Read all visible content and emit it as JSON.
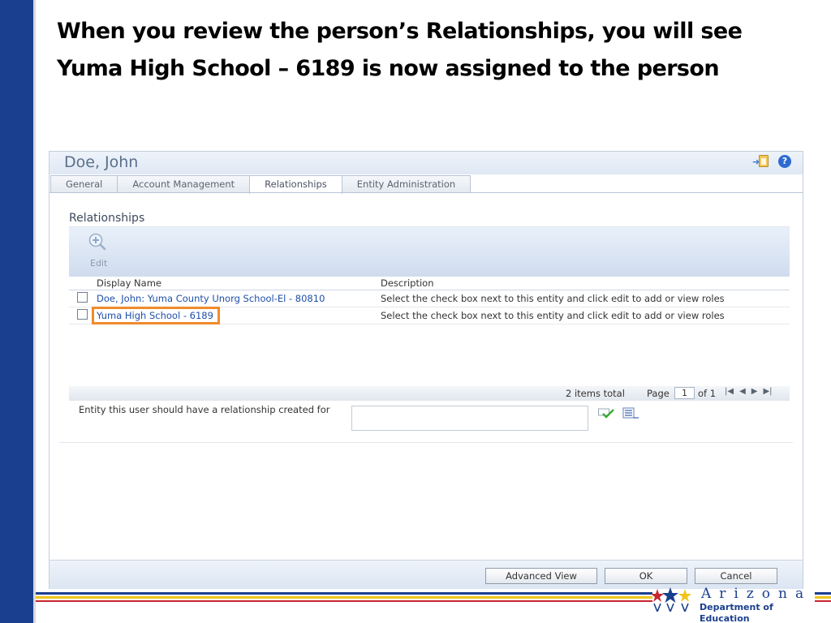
{
  "slide": {
    "title": "When you review the person’s Relationships, you will see Yuma High School – 6189 is now assigned to the person"
  },
  "app": {
    "title": "Doe, John",
    "tabs": [
      {
        "label": "General"
      },
      {
        "label": "Account Management"
      },
      {
        "label": "Relationships",
        "active": true
      },
      {
        "label": "Entity Administration"
      }
    ],
    "section_label": "Relationships",
    "toolbar": {
      "edit_label": "Edit"
    },
    "grid": {
      "columns": [
        "Display Name",
        "Description"
      ],
      "rows": [
        {
          "name": "Doe, John: Yuma County Unorg School-El - 80810",
          "description": "Select the check box next to this entity and click edit to add or view roles"
        },
        {
          "name": "Yuma High School - 6189",
          "description": "Select the check box next to this entity and click edit to add or view roles",
          "highlighted": true
        }
      ],
      "footer": {
        "items_total": "2 items total",
        "page_label": "Page",
        "page_value": "1",
        "page_of": "of 1"
      }
    },
    "entity_label": "Entity this user should have a relationship created for",
    "buttons": {
      "advanced_view": "Advanced View",
      "ok": "OK",
      "cancel": "Cancel"
    }
  },
  "branding": {
    "arizona": "Arizona",
    "department": "Department of Education"
  },
  "colors": {
    "left_bar": "#1a3f8f",
    "highlight": "#f08b2c",
    "link": "#1f4fa8"
  }
}
